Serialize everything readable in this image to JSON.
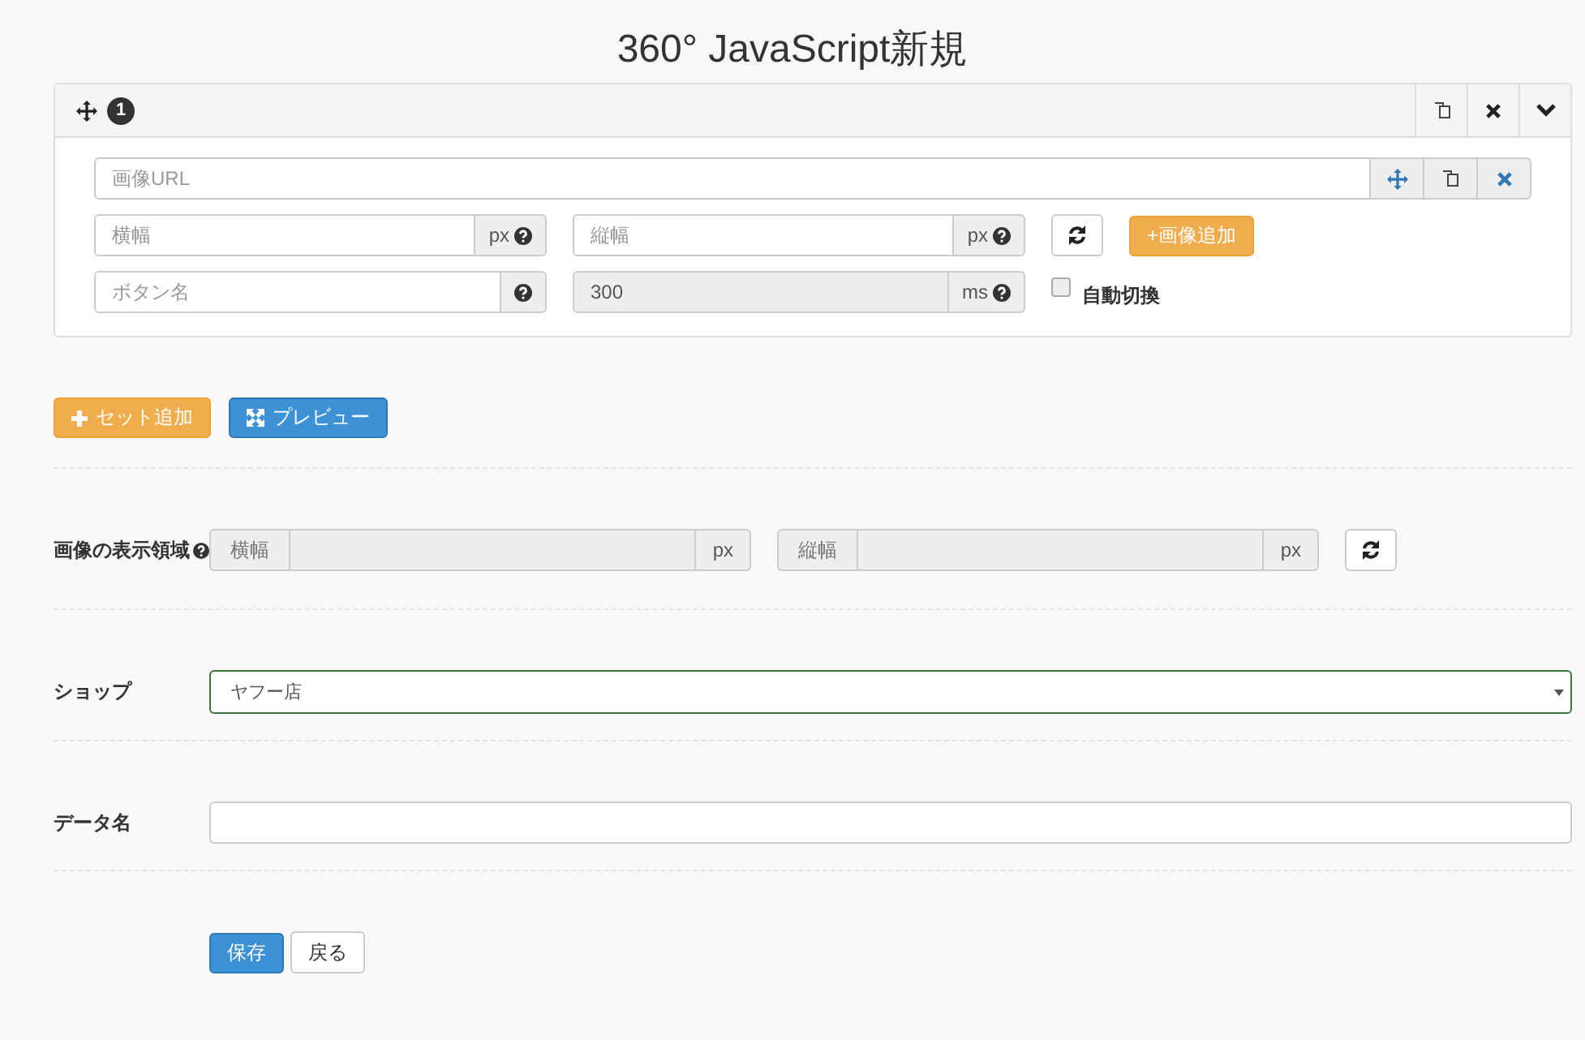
{
  "title": "360° JavaScript新規",
  "panel": {
    "number": "1",
    "url_field": {
      "placeholder": "画像URL"
    },
    "width_field": {
      "placeholder": "横幅",
      "unit": "px",
      "disabled": false
    },
    "height_field": {
      "placeholder": "縦幅",
      "unit": "px",
      "disabled": false
    },
    "button_name_field": {
      "placeholder": "ボタン名",
      "disabled": false
    },
    "interval_field": {
      "value": "300",
      "unit": "ms",
      "disabled": true
    },
    "add_image_button": "+画像追加",
    "auto_switch": {
      "label": "自動切換",
      "checked": false
    }
  },
  "actions": [
    {
      "kind": "add",
      "label": "セット追加"
    },
    {
      "kind": "preview",
      "label": "プレビュー"
    }
  ],
  "display_area": {
    "label": "画像の表示領域",
    "width": {
      "addon": "横幅",
      "unit": "px",
      "disabled": true
    },
    "height": {
      "addon": "縦幅",
      "unit": "px",
      "disabled": true
    }
  },
  "shop": {
    "label": "ショップ",
    "value": "ヤフー店"
  },
  "data_name": {
    "label": "データ名"
  },
  "buttons": [
    {
      "kind": "primary",
      "label": "保存"
    },
    {
      "kind": "default",
      "label": "戻る"
    }
  ]
}
